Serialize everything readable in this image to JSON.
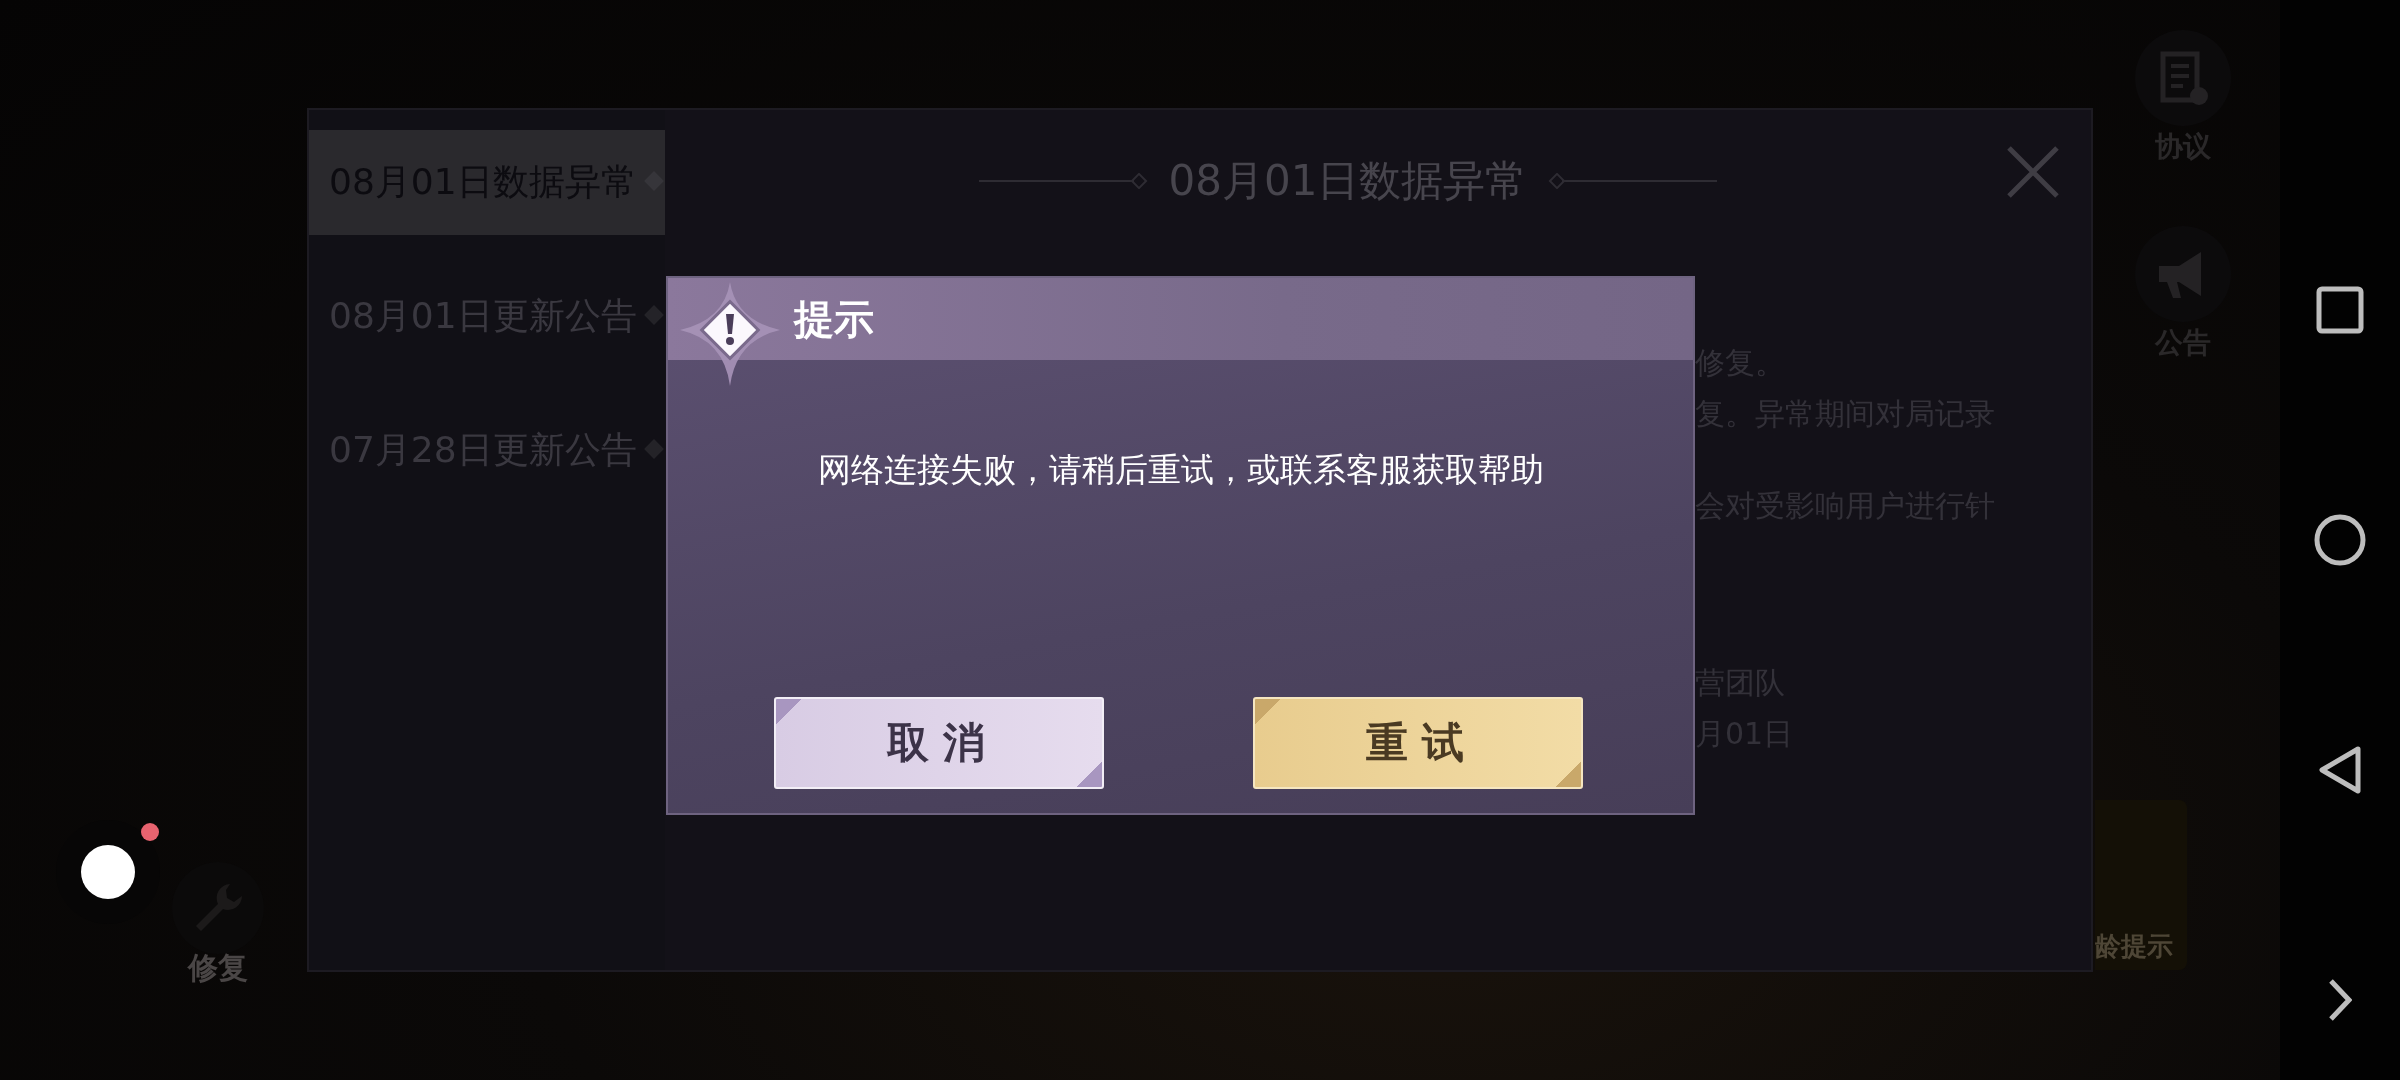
{
  "game_background": {
    "side_buttons": [
      {
        "kind": "agreement",
        "label": "协议"
      },
      {
        "kind": "announcement",
        "label": "公告"
      }
    ],
    "repair_button": {
      "label": "修复"
    },
    "age_notice": {
      "label": "龄提示"
    }
  },
  "announcement_panel": {
    "tabs": [
      {
        "label": "08月01日数据异常",
        "selected": true
      },
      {
        "label": "08月01日更新公告",
        "selected": false
      },
      {
        "label": "07月28日更新公告",
        "selected": false
      }
    ],
    "title": "08月01日数据异常",
    "paragraphs": [
      [
        "修复。",
        "复。异常期间对局记录"
      ],
      [
        "会对受影响用户进行针"
      ],
      [
        "营团队",
        "月01日"
      ]
    ]
  },
  "dialog": {
    "title": "提示",
    "message": "网络连接失败，请稍后重试，或联系客服获取帮助",
    "buttons": [
      {
        "kind": "cancel",
        "label": "取消"
      },
      {
        "kind": "confirm",
        "label": "重试"
      }
    ]
  },
  "floating_ball": {
    "badge": true
  },
  "nav_bar": [
    {
      "kind": "recents"
    },
    {
      "kind": "home"
    },
    {
      "kind": "back"
    },
    {
      "kind": "expand"
    }
  ]
}
